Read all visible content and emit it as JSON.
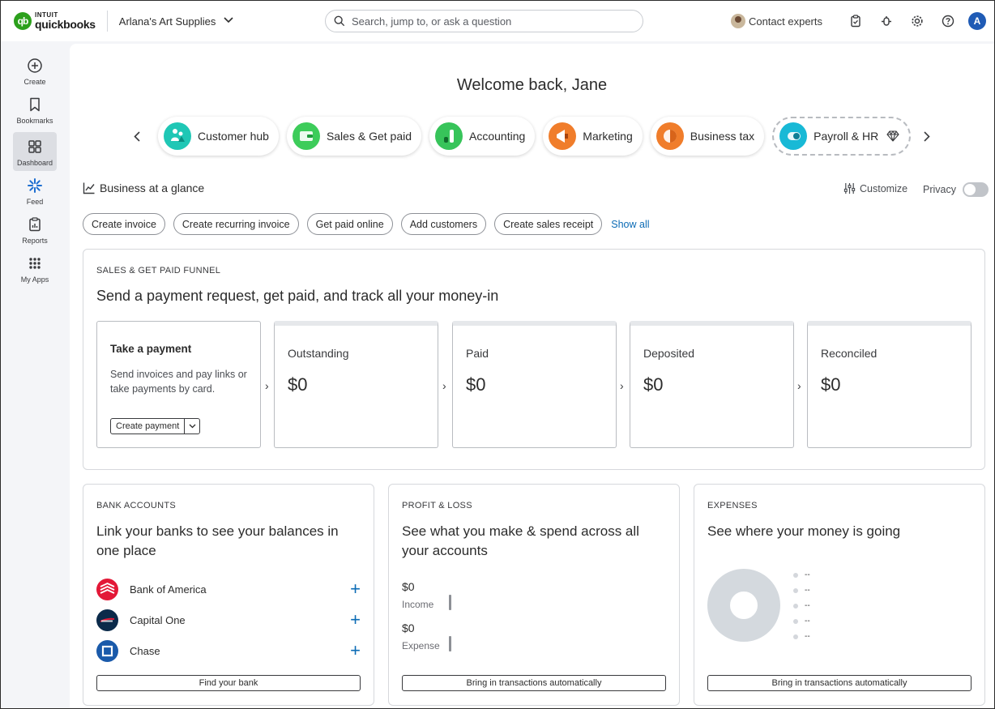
{
  "header": {
    "brand_top": "INTUIT",
    "brand_name": "quickbooks",
    "company": "Arlana's Art Supplies",
    "search_placeholder": "Search, jump to, or ask a question",
    "contact_label": "Contact experts",
    "user_initial": "A"
  },
  "sidebar": {
    "items": [
      {
        "label": "Create",
        "icon": "plus-circle-icon"
      },
      {
        "label": "Bookmarks",
        "icon": "bookmark-icon"
      },
      {
        "label": "Dashboard",
        "icon": "dashboard-icon"
      },
      {
        "label": "Feed",
        "icon": "feed-icon"
      },
      {
        "label": "Reports",
        "icon": "reports-icon"
      },
      {
        "label": "My Apps",
        "icon": "apps-grid-icon"
      }
    ]
  },
  "main": {
    "welcome": "Welcome back, Jane",
    "hubs": [
      {
        "label": "Customer hub",
        "color": "#1fc7b5"
      },
      {
        "label": "Sales & Get paid",
        "color": "#3dcc5a"
      },
      {
        "label": "Accounting",
        "color": "#37c45a"
      },
      {
        "label": "Marketing",
        "color": "#f07d2b"
      },
      {
        "label": "Business tax",
        "color": "#f07d2b"
      },
      {
        "label": "Payroll & HR",
        "color": "#18b9d6"
      }
    ],
    "glance_title": "Business at a glance",
    "customize_label": "Customize",
    "privacy_label": "Privacy",
    "actions": [
      "Create invoice",
      "Create recurring invoice",
      "Get paid online",
      "Add customers",
      "Create sales receipt"
    ],
    "show_all": "Show all"
  },
  "funnel": {
    "eyebrow": "SALES & GET PAID FUNNEL",
    "title": "Send a payment request, get paid, and track all your money-in",
    "take_payment": {
      "title": "Take a payment",
      "description": "Send invoices and pay links or take payments by card.",
      "button": "Create payment"
    },
    "stages": [
      {
        "label": "Outstanding",
        "value": "$0"
      },
      {
        "label": "Paid",
        "value": "$0"
      },
      {
        "label": "Deposited",
        "value": "$0"
      },
      {
        "label": "Reconciled",
        "value": "$0"
      }
    ]
  },
  "bank_accounts": {
    "eyebrow": "BANK ACCOUNTS",
    "title": "Link your banks to see your balances in one place",
    "banks": [
      "Bank of America",
      "Capital One",
      "Chase"
    ],
    "button": "Find your bank"
  },
  "profit_loss": {
    "eyebrow": "PROFIT & LOSS",
    "title": "See what you make & spend across all your accounts",
    "income_amount": "$0",
    "income_label": "Income",
    "expense_amount": "$0",
    "expense_label": "Expense",
    "button": "Bring in transactions automatically"
  },
  "expenses": {
    "eyebrow": "EXPENSES",
    "title": "See where your money is going",
    "legend": [
      "--",
      "--",
      "--",
      "--",
      "--"
    ],
    "button": "Bring in transactions automatically"
  },
  "colors": {
    "brand_green": "#2ca01c",
    "link_blue": "#0b6bb5",
    "donut_gray": "#d4d9de"
  }
}
